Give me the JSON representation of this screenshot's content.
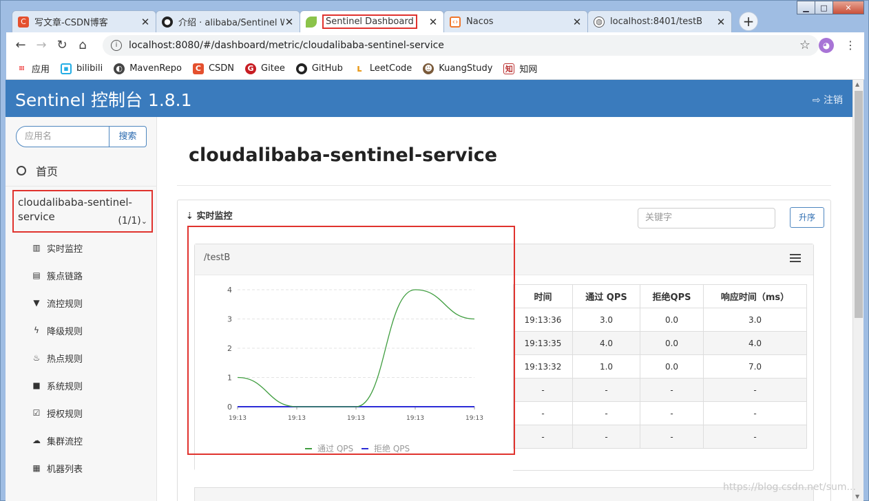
{
  "browser": {
    "window_controls": {
      "minimize": "▁",
      "maximize": "□",
      "close": "✕"
    },
    "tabs": [
      {
        "title": "写文章-CSDN博客",
        "icon": "csdn-icon",
        "active": false
      },
      {
        "title": "介绍 · alibaba/Sentinel Wi",
        "icon": "github-icon",
        "active": false
      },
      {
        "title": "Sentinel Dashboard",
        "icon": "spring-leaf-icon",
        "active": true
      },
      {
        "title": "Nacos",
        "icon": "nacos-icon",
        "active": false
      },
      {
        "title": "localhost:8401/testB",
        "icon": "globe-icon",
        "active": false
      }
    ],
    "new_tab": "+",
    "url": "localhost:8080/#/dashboard/metric/cloudalibaba-sentinel-service",
    "bookmarks": [
      {
        "label": "应用",
        "icon": "apps-icon"
      },
      {
        "label": "bilibili",
        "icon": "bilibili-icon"
      },
      {
        "label": "MavenRepo",
        "icon": "mavenrepo-icon"
      },
      {
        "label": "CSDN",
        "icon": "csdn-icon"
      },
      {
        "label": "Gitee",
        "icon": "gitee-icon"
      },
      {
        "label": "GitHub",
        "icon": "github-icon"
      },
      {
        "label": "LeetCode",
        "icon": "leetcode-icon"
      },
      {
        "label": "KuangStudy",
        "icon": "kuangstudy-icon"
      },
      {
        "label": "知网",
        "icon": "cnki-icon"
      }
    ]
  },
  "app": {
    "brand": "Sentinel 控制台 1.8.1",
    "logout": "注销",
    "sidebar": {
      "search_placeholder": "应用名",
      "search_button": "搜索",
      "home": "首页",
      "app_name": "cloudalibaba-sentinel-service",
      "app_count": "(1/1)",
      "menu": [
        {
          "label": "实时监控",
          "icon": "bar-chart-icon"
        },
        {
          "label": "簇点链路",
          "icon": "list-icon"
        },
        {
          "label": "流控规则",
          "icon": "filter-icon"
        },
        {
          "label": "降级规则",
          "icon": "bolt-icon"
        },
        {
          "label": "热点规则",
          "icon": "fire-icon"
        },
        {
          "label": "系统规则",
          "icon": "lock-icon"
        },
        {
          "label": "授权规则",
          "icon": "check-square-icon"
        },
        {
          "label": "集群流控",
          "icon": "cloud-icon"
        },
        {
          "label": "机器列表",
          "icon": "grid-icon"
        }
      ]
    },
    "main": {
      "title": "cloudalibaba-sentinel-service",
      "section": "实时监控",
      "keyword_placeholder": "关键字",
      "sort_button": "升序",
      "resource": "/testB",
      "table": {
        "headers": [
          "时间",
          "通过 QPS",
          "拒绝QPS",
          "响应时间（ms）"
        ],
        "rows": [
          [
            "19:13:36",
            "3.0",
            "0.0",
            "3.0"
          ],
          [
            "19:13:35",
            "4.0",
            "0.0",
            "4.0"
          ],
          [
            "19:13:32",
            "1.0",
            "0.0",
            "7.0"
          ],
          [
            "-",
            "-",
            "-",
            "-"
          ],
          [
            "-",
            "-",
            "-",
            "-"
          ],
          [
            "-",
            "-",
            "-",
            "-"
          ]
        ]
      }
    }
  },
  "chart_data": {
    "type": "line",
    "x": [
      "19:13",
      "19:13",
      "19:13",
      "19:13",
      "19:13"
    ],
    "ylim": [
      0,
      4
    ],
    "yticks": [
      "4",
      "3",
      "2",
      "1",
      "0"
    ],
    "series": [
      {
        "name": "通过 QPS",
        "color": "#3f9d3f",
        "values": [
          1,
          0,
          0,
          4,
          3
        ]
      },
      {
        "name": "拒绝 QPS",
        "color": "#2b2bd6",
        "values": [
          0,
          0,
          0,
          0,
          0
        ]
      }
    ],
    "grid": true,
    "legend": "bottom"
  },
  "watermark": "https://blog.csdn.net/sum..."
}
